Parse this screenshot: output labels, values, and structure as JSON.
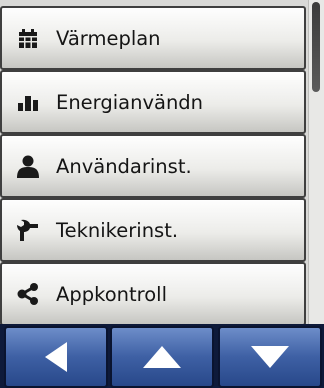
{
  "menu": {
    "items": [
      {
        "label": "Värmeplan",
        "icon": "calendar-icon"
      },
      {
        "label": "Energianvändn",
        "icon": "bar-chart-icon"
      },
      {
        "label": "Användarinst.",
        "icon": "user-icon"
      },
      {
        "label": "Teknikerinst.",
        "icon": "wrench-icon"
      },
      {
        "label": "Appkontroll",
        "icon": "share-icon"
      }
    ]
  },
  "navigation": {
    "back": {
      "icon": "triangle-left-icon"
    },
    "up": {
      "icon": "triangle-up-icon"
    },
    "down": {
      "icon": "triangle-down-icon"
    }
  },
  "colors": {
    "nav_blue": "#3e60a4",
    "icon_dark": "#1a1a1a"
  }
}
